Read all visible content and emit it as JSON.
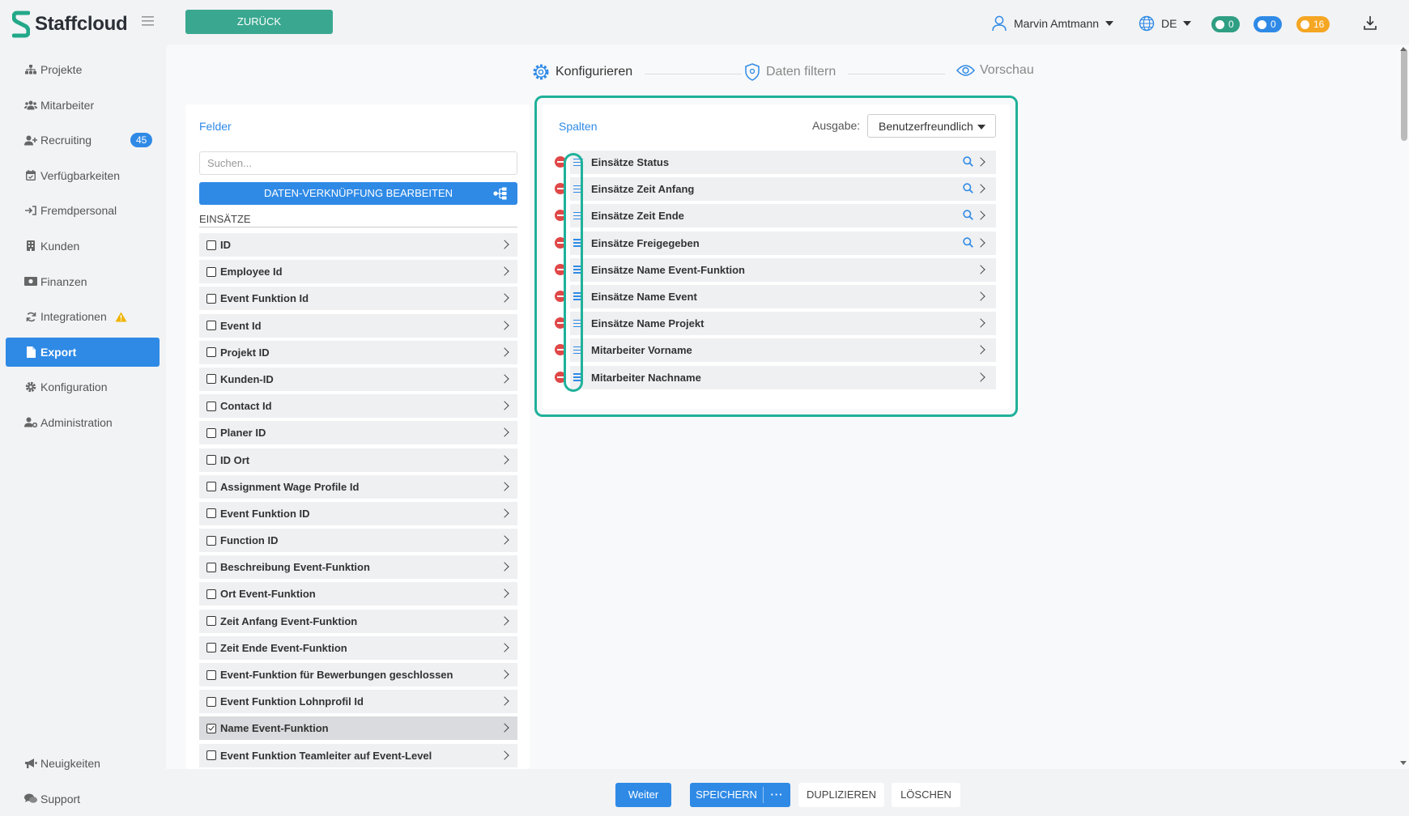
{
  "app": {
    "name": "Staffcloud"
  },
  "sidebar": {
    "items": [
      {
        "label": "Projekte",
        "icon": "sitemap-icon"
      },
      {
        "label": "Mitarbeiter",
        "icon": "users-icon"
      },
      {
        "label": "Recruiting",
        "icon": "user-plus-icon",
        "badge": "45"
      },
      {
        "label": "Verfügbarkeiten",
        "icon": "calendar-check-icon"
      },
      {
        "label": "Fremdpersonal",
        "icon": "sign-in-icon"
      },
      {
        "label": "Kunden",
        "icon": "building-icon"
      },
      {
        "label": "Finanzen",
        "icon": "money-icon"
      },
      {
        "label": "Integrationen",
        "icon": "sync-icon",
        "warning": true
      },
      {
        "label": "Export",
        "icon": "file-icon",
        "active": true
      },
      {
        "label": "Konfiguration",
        "icon": "gear-icon"
      },
      {
        "label": "Administration",
        "icon": "user-cog-icon"
      }
    ],
    "bottom": [
      {
        "label": "Neuigkeiten",
        "icon": "megaphone-icon"
      },
      {
        "label": "Support",
        "icon": "comments-icon"
      }
    ]
  },
  "topbar": {
    "back_label": "ZURÜCK",
    "user_name": "Marvin Amtmann",
    "language": "DE",
    "counters": {
      "messages": "0",
      "notifications": "0",
      "warnings": "16"
    },
    "colors": {
      "messages": "#2f9e83",
      "notifications": "#2f8ae6",
      "warnings": "#f5a623"
    }
  },
  "stepper": {
    "steps": [
      {
        "label": "Konfigurieren",
        "active": true
      },
      {
        "label": "Daten filtern",
        "active": false
      },
      {
        "label": "Vorschau",
        "active": false
      }
    ]
  },
  "fields": {
    "title": "Felder",
    "search_placeholder": "Suchen...",
    "link_button": "DATEN-VERKNÜPFUNG BEARBEITEN",
    "section": "EINSÄTZE",
    "items": [
      {
        "label": "ID",
        "checked": false
      },
      {
        "label": "Employee Id",
        "checked": false
      },
      {
        "label": "Event Funktion Id",
        "checked": false
      },
      {
        "label": "Event Id",
        "checked": false
      },
      {
        "label": "Projekt ID",
        "checked": false
      },
      {
        "label": "Kunden-ID",
        "checked": false
      },
      {
        "label": "Contact Id",
        "checked": false
      },
      {
        "label": "Planer ID",
        "checked": false
      },
      {
        "label": "ID Ort",
        "checked": false
      },
      {
        "label": "Assignment Wage Profile Id",
        "checked": false
      },
      {
        "label": "Event Funktion ID",
        "checked": false
      },
      {
        "label": "Function ID",
        "checked": false
      },
      {
        "label": "Beschreibung Event-Funktion",
        "checked": false
      },
      {
        "label": "Ort Event-Funktion",
        "checked": false
      },
      {
        "label": "Zeit Anfang Event-Funktion",
        "checked": false
      },
      {
        "label": "Zeit Ende Event-Funktion",
        "checked": false
      },
      {
        "label": "Event-Funktion für Bewerbungen geschlossen",
        "checked": false
      },
      {
        "label": "Event Funktion Lohnprofil Id",
        "checked": false
      },
      {
        "label": "Name Event-Funktion",
        "checked": true
      },
      {
        "label": "Event Funktion Teamleiter auf Event-Level",
        "checked": false
      }
    ]
  },
  "columns": {
    "title": "Spalten",
    "output_label": "Ausgabe:",
    "output_value": "Benutzerfreundlich",
    "items": [
      {
        "label": "Einsätze Status",
        "searchable": true
      },
      {
        "label": "Einsätze Zeit Anfang",
        "searchable": true
      },
      {
        "label": "Einsätze Zeit Ende",
        "searchable": true
      },
      {
        "label": "Einsätze Freigegeben",
        "searchable": true
      },
      {
        "label": "Einsätze Name Event-Funktion",
        "searchable": false
      },
      {
        "label": "Einsätze Name Event",
        "searchable": false
      },
      {
        "label": "Einsätze Name Projekt",
        "searchable": false
      },
      {
        "label": "Mitarbeiter Vorname",
        "searchable": false
      },
      {
        "label": "Mitarbeiter Nachname",
        "searchable": false
      }
    ]
  },
  "footer": {
    "next": "Weiter",
    "save": "SPEICHERN",
    "more": "···",
    "duplicate": "DUPLIZIEREN",
    "delete": "LÖSCHEN"
  },
  "colors": {
    "primary": "#2f8ae6",
    "accent": "#3aa890",
    "highlight": "#1eb19a",
    "danger": "#e04848"
  }
}
